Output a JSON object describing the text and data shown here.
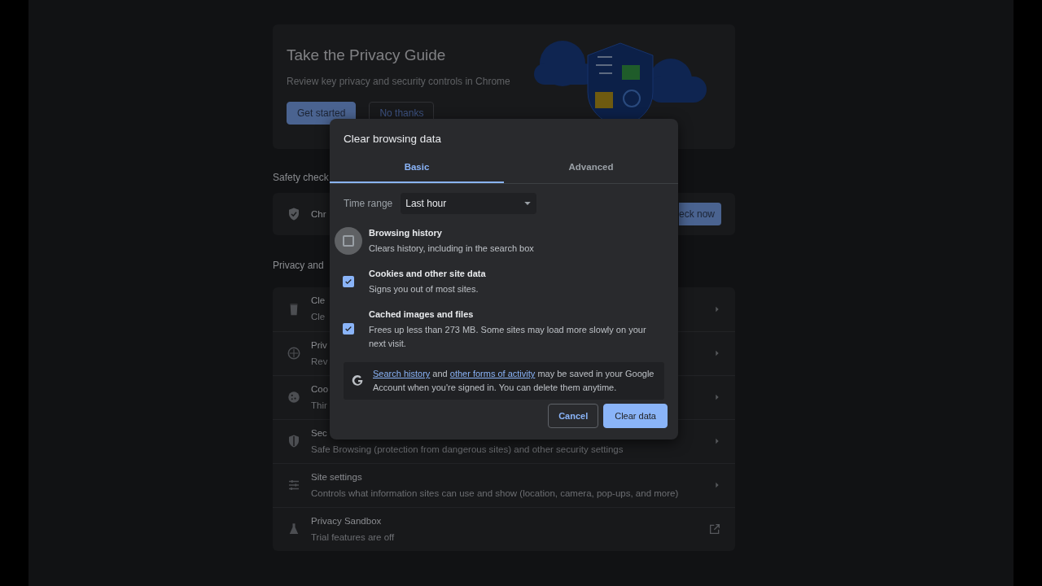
{
  "privacy_guide": {
    "title": "Take the Privacy Guide",
    "subtitle": "Review key privacy and security controls in Chrome",
    "buttons": [
      {
        "label": "Get started",
        "kind": "primary"
      },
      {
        "label": "No thanks",
        "kind": "outline"
      }
    ]
  },
  "safety_check": {
    "heading": "Safety check",
    "item_title": "Chr",
    "button": "eck now"
  },
  "privacy_section": {
    "heading": "Privacy and",
    "rows": [
      {
        "title": "Cle",
        "subtitle": "Cle",
        "kind": "submenu"
      },
      {
        "title": "Priv",
        "subtitle": "Rev",
        "kind": "submenu"
      },
      {
        "title": "Coo",
        "subtitle": "Thir",
        "kind": "submenu"
      },
      {
        "title": "Sec",
        "subtitle": "Safe Browsing (protection from dangerous sites) and other security settings",
        "kind": "submenu"
      },
      {
        "title": "Site settings",
        "subtitle": "Controls what information sites can use and show (location, camera, pop-ups, and more)",
        "kind": "submenu"
      },
      {
        "title": "Privacy Sandbox",
        "subtitle": "Trial features are off",
        "kind": "external"
      }
    ]
  },
  "dialog": {
    "title": "Clear browsing data",
    "tabs": [
      {
        "label": "Basic",
        "selected": true
      },
      {
        "label": "Advanced",
        "selected": false
      }
    ],
    "time_range": {
      "label": "Time range",
      "value": "Last hour"
    },
    "options": [
      {
        "title": "Browsing history",
        "description": "Clears history, including in the search box",
        "checked": false,
        "focused": true
      },
      {
        "title": "Cookies and other site data",
        "description": "Signs you out of most sites.",
        "checked": true,
        "focused": false
      },
      {
        "title": "Cached images and files",
        "description": "Frees up less than 273 MB. Some sites may load more slowly on your next visit.",
        "checked": true,
        "focused": false
      }
    ],
    "notice": [
      {
        "kind": "link",
        "text": "Search history"
      },
      {
        "kind": "text",
        "text": " and "
      },
      {
        "kind": "link",
        "text": "other forms of activity"
      },
      {
        "kind": "text",
        "text": " may be saved in your Google Account when you're signed in. You can delete them anytime."
      }
    ],
    "buttons": [
      {
        "label": "Cancel",
        "kind": "outline"
      },
      {
        "label": "Clear data",
        "kind": "primary"
      }
    ]
  }
}
